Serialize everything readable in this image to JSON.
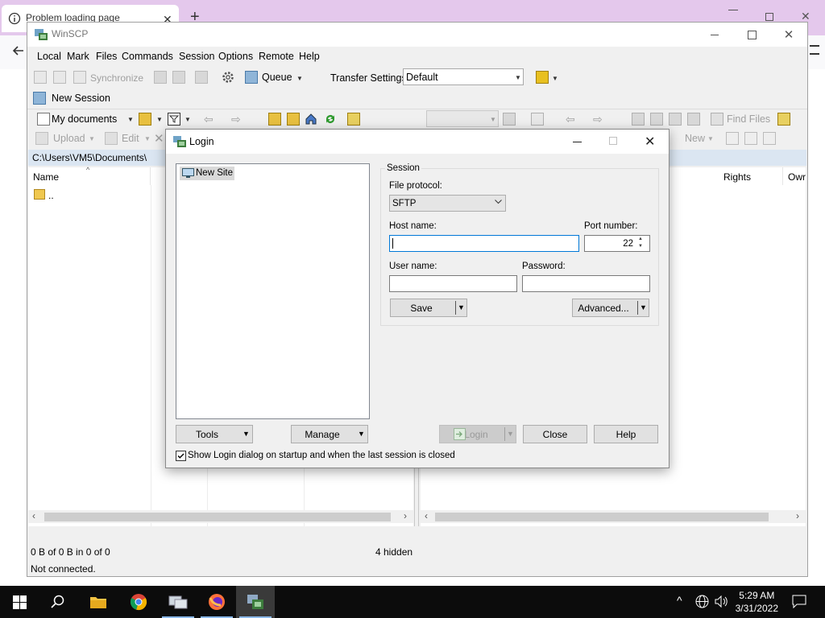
{
  "browser": {
    "tab_title": "Problem loading page",
    "new_tab_symbol": "+"
  },
  "app": {
    "title": "WinSCP"
  },
  "menu": [
    "Local",
    "Mark",
    "Files",
    "Commands",
    "Session",
    "Options",
    "Remote",
    "Help"
  ],
  "toolbar": {
    "synchronize": "Synchronize",
    "queue": "Queue",
    "transfer_settings_label": "Transfer Settings",
    "transfer_settings_value": "Default"
  },
  "session_tab": {
    "label": "New Session"
  },
  "local_toolbar": {
    "location": "My documents",
    "upload": "Upload",
    "edit": "Edit"
  },
  "remote_toolbar": {
    "find_files": "Find Files",
    "new": "New"
  },
  "local_panel": {
    "path": "C:\\Users\\VM5\\Documents\\",
    "columns": [
      "Name"
    ],
    "rows": [
      ".."
    ]
  },
  "remote_panel": {
    "columns": [
      "Rights",
      "Owr"
    ]
  },
  "status": {
    "selection": "0 B of 0 B in 0 of 0",
    "hidden": "4 hidden",
    "connection": "Not connected."
  },
  "login_dialog": {
    "title": "Login",
    "sites": [
      "New Site"
    ],
    "session_group": "Session",
    "file_protocol_label": "File protocol:",
    "file_protocol_value": "SFTP",
    "host_name_label": "Host name:",
    "host_name_value": "",
    "port_label": "Port number:",
    "port_value": "22",
    "user_name_label": "User name:",
    "user_name_value": "",
    "password_label": "Password:",
    "password_value": "",
    "save_button": "Save",
    "advanced_button": "Advanced...",
    "tools_button": "Tools",
    "manage_button": "Manage",
    "login_button": "Login",
    "close_button": "Close",
    "help_button": "Help",
    "startup_checkbox_label": "Show Login dialog on startup and when the last session is closed",
    "startup_checkbox_checked": true
  },
  "taskbar": {
    "time": "5:29 AM",
    "date": "3/31/2022"
  },
  "colors": {
    "browser_tabbar": "#e4c8ec",
    "path_bar": "#dbe6f2",
    "taskbar": "#0c0c0c",
    "focus_border": "#0078d7"
  }
}
